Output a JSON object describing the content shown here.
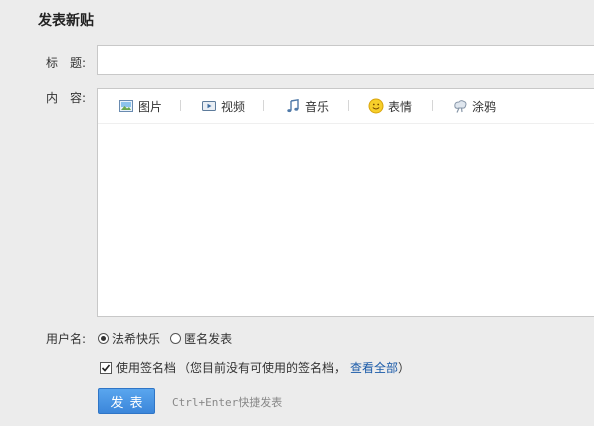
{
  "page_title": "发表新贴",
  "form": {
    "title_label": "标　题:",
    "title_value": "",
    "content_label": "内　容:"
  },
  "toolbar": {
    "items": [
      {
        "label": "图片",
        "icon": "image-icon"
      },
      {
        "label": "视频",
        "icon": "video-icon"
      },
      {
        "label": "音乐",
        "icon": "music-icon"
      },
      {
        "label": "表情",
        "icon": "emoji-icon"
      },
      {
        "label": "涂鸦",
        "icon": "doodle-icon"
      }
    ]
  },
  "user": {
    "label": "用户名:",
    "option_name": "法希快乐",
    "option_anonymous": "匿名发表",
    "selected": "option_name"
  },
  "signature": {
    "checked": true,
    "label": "使用签名档",
    "note": "（您目前没有可使用的签名档，",
    "link": "查看全部",
    "note_end": "）"
  },
  "submit": {
    "label": "发表",
    "hint_keys": "Ctrl+Enter",
    "hint_text": "快捷发表"
  }
}
